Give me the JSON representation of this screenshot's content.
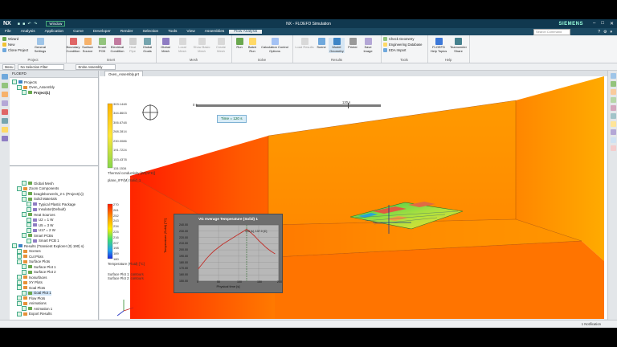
{
  "window": {
    "nx_label": "NX",
    "window_menu": "Window",
    "title": "NX - FLOEFD Simulation",
    "brand": "SIEMENS",
    "search_placeholder": "Search Command"
  },
  "menu": {
    "items": [
      "File",
      "Analysis",
      "Application",
      "Curve",
      "Developer",
      "Render",
      "Selection",
      "Tools",
      "View",
      "Assemblies",
      "Flow Analysis"
    ],
    "active": "Flow Analysis"
  },
  "ribbon": {
    "project_items": [
      "Wizard",
      "New",
      "Clone Project"
    ],
    "project_btn": "General Settings",
    "groups": [
      "Project",
      "Insert",
      "Mesh",
      "Solve",
      "Results",
      "Tools",
      "Help"
    ],
    "insert": [
      "Boundary Condition",
      "Surface Source",
      "Smart PCB",
      "Electrical Condition",
      "Heat Pipe",
      "Global Goals"
    ],
    "mesh": [
      "Global Mesh",
      "Local Mesh",
      "Show Basic Mesh",
      "Create Mesh"
    ],
    "solve": [
      "Run",
      "Batch Run",
      "Calculation Control Options"
    ],
    "results": [
      "Load Results",
      "Scene",
      "Model Geometry",
      "Printer",
      "Save Image"
    ],
    "tools_items": [
      "Check Geometry",
      "Engineering Database",
      "EDA Import"
    ],
    "help": [
      "FLOEFD Help Topics",
      "Teamcenter Share"
    ]
  },
  "selection": {
    "menu": "Menu",
    "filter": "No Selection Filter",
    "scope": "Entire Assembly"
  },
  "navigator": {
    "header": "FLOEFD",
    "top_nodes": [
      {
        "label": "Projects",
        "depth": 0
      },
      {
        "label": "Oven_Assembly",
        "depth": 1
      },
      {
        "label": "Project(1)",
        "depth": 2,
        "bold": true
      }
    ],
    "nodes": [
      {
        "label": "Global Mesh",
        "depth": 2
      },
      {
        "label": "Zoom Components",
        "depth": 1
      },
      {
        "label": "beaglebonerels_2-1 (Project(1))",
        "depth": 2
      },
      {
        "label": "Solid Materials",
        "depth": 2
      },
      {
        "label": "Typical Plastic Package",
        "depth": 3
      },
      {
        "label": "Insulator(Default)",
        "depth": 3
      },
      {
        "label": "Heat Sources",
        "depth": 2
      },
      {
        "label": "U2 = 1 W",
        "depth": 3
      },
      {
        "label": "U5 = 3 W",
        "depth": 3
      },
      {
        "label": "U17 = 2 W",
        "depth": 3
      },
      {
        "label": "Smart PCBs",
        "depth": 2
      },
      {
        "label": "Smart PCB 1",
        "depth": 3
      },
      {
        "label": "Results (Transient Explorer (0) 190) s)",
        "depth": 0
      },
      {
        "label": "Scenes",
        "depth": 1
      },
      {
        "label": "Cut Plots",
        "depth": 1
      },
      {
        "label": "Surface Plots",
        "depth": 1
      },
      {
        "label": "Surface Plot 1",
        "depth": 2
      },
      {
        "label": "Surface Plot 2",
        "depth": 2
      },
      {
        "label": "Isosurfaces",
        "depth": 1
      },
      {
        "label": "XY Plots",
        "depth": 1
      },
      {
        "label": "Goal Plots",
        "depth": 1
      },
      {
        "label": "Goal Plot 1",
        "depth": 2,
        "selected": true
      },
      {
        "label": "Flow Plots",
        "depth": 1
      },
      {
        "label": "Animations",
        "depth": 1
      },
      {
        "label": "Animation 1",
        "depth": 2
      },
      {
        "label": "Export Results",
        "depth": 1
      }
    ]
  },
  "viewport": {
    "tab": "Oven_Assembly.prt",
    "time_marker": "120 s",
    "time_box": "Time = 120 s",
    "timeline_start": "0 s",
    "timeline_progress": 0.82,
    "legend_top": {
      "values": [
        "303.1448",
        "344.8603",
        "306.6748",
        "268.2814",
        "230.0086",
        "191.7224",
        "153.4378",
        "115.1534"
      ],
      "title": "Thermal conductivity [W/(m*K)]",
      "subtitle": "plane_IFF(M) Solid_1"
    },
    "legend_bottom": {
      "values": [
        "270",
        "261",
        "252",
        "243",
        "234",
        "225",
        "216",
        "207",
        "198",
        "189",
        "180"
      ],
      "title": "Temperature (Fluid) [°C]"
    },
    "surface_notes": [
      "Surface Plot 1: contours",
      "Surface Plot 2: contours"
    ]
  },
  "goal_plot": {
    "title": "VG Average Temperature (Solid) 1",
    "ylabel": "Temperature (Solid) [°C]",
    "xlabel": "Physical time [s]",
    "annotation": "120 [s], 137.0 [C]",
    "y_ticks": [
      "240.00",
      "230.00",
      "220.00",
      "210.00",
      "200.00",
      "190.00",
      "180.00",
      "170.00",
      "160.00",
      "150.00"
    ],
    "x_ticks": [
      "0",
      "50",
      "100",
      "150",
      "200"
    ]
  },
  "status": {
    "notification": "1 Notification"
  },
  "chart_data": {
    "type": "line",
    "title": "VG Average Temperature (Solid) 1",
    "xlabel": "Physical time [s]",
    "ylabel": "Temperature (Solid) [°C]",
    "x": [
      0,
      10,
      20,
      30,
      40,
      50,
      60,
      70,
      80,
      90,
      100,
      110,
      120,
      130,
      140,
      150,
      160,
      170,
      180,
      190
    ],
    "series": [
      {
        "values": [
          170,
          178,
          186,
          193,
          199,
          204,
          209,
          213,
          217,
          221,
          225,
          229,
          233,
          228,
          222,
          215,
          209,
          203,
          198,
          194
        ]
      }
    ],
    "xlim": [
      0,
      200
    ],
    "ylim": [
      150,
      240
    ],
    "grid": true,
    "marker_x": 120
  }
}
